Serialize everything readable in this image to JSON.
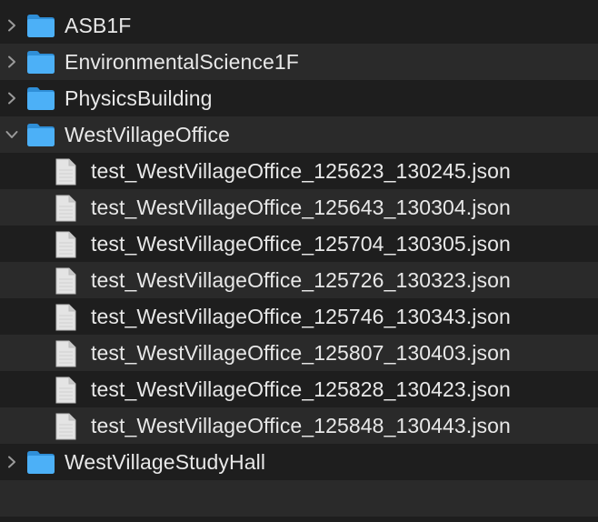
{
  "tree": {
    "folders": [
      {
        "name": "ASB1F",
        "expanded": false
      },
      {
        "name": "EnvironmentalScience1F",
        "expanded": false
      },
      {
        "name": "PhysicsBuilding",
        "expanded": false
      },
      {
        "name": "WestVillageOffice",
        "expanded": true,
        "files": [
          "test_WestVillageOffice_125623_130245.json",
          "test_WestVillageOffice_125643_130304.json",
          "test_WestVillageOffice_125704_130305.json",
          "test_WestVillageOffice_125726_130323.json",
          "test_WestVillageOffice_125746_130343.json",
          "test_WestVillageOffice_125807_130403.json",
          "test_WestVillageOffice_125828_130423.json",
          "test_WestVillageOffice_125848_130443.json"
        ]
      },
      {
        "name": "WestVillageStudyHall",
        "expanded": false
      }
    ]
  },
  "icons": {
    "folder": "folder-icon",
    "file": "document-icon",
    "collapsed": "chevron-right-icon",
    "expanded": "chevron-down-icon"
  },
  "colors": {
    "background": "#1e1e1e",
    "alternate_row": "#2a2a2a",
    "text": "#e8e8e8",
    "folder_blue": "#3fa9f5"
  }
}
